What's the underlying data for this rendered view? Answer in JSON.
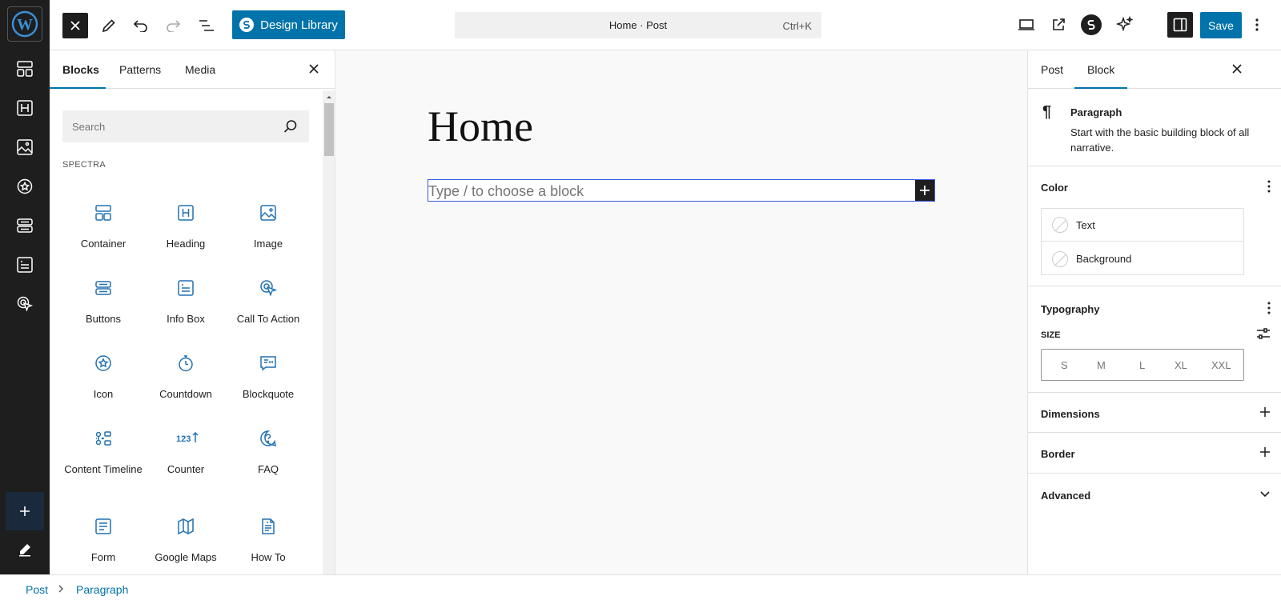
{
  "topbar": {
    "design_library_label": "Design Library",
    "command_title": "Home · Post",
    "command_shortcut": "Ctrl+K",
    "save_label": "Save"
  },
  "inserter": {
    "tabs": [
      "Blocks",
      "Patterns",
      "Media"
    ],
    "search_placeholder": "Search",
    "category": "SPECTRA",
    "blocks": [
      {
        "label": "Container",
        "icon": "container-icon"
      },
      {
        "label": "Heading",
        "icon": "heading-icon"
      },
      {
        "label": "Image",
        "icon": "image-icon"
      },
      {
        "label": "Buttons",
        "icon": "buttons-icon"
      },
      {
        "label": "Info Box",
        "icon": "info-box-icon"
      },
      {
        "label": "Call To Action",
        "icon": "call-to-action-icon"
      },
      {
        "label": "Icon",
        "icon": "star-badge-icon"
      },
      {
        "label": "Countdown",
        "icon": "stopwatch-icon"
      },
      {
        "label": "Blockquote",
        "icon": "blockquote-icon"
      },
      {
        "label": "Content Timeline",
        "icon": "timeline-icon"
      },
      {
        "label": "Counter",
        "icon": "counter-icon"
      },
      {
        "label": "FAQ",
        "icon": "faq-icon"
      },
      {
        "label": "Form",
        "icon": "form-icon"
      },
      {
        "label": "Google Maps",
        "icon": "map-icon"
      },
      {
        "label": "How To",
        "icon": "how-to-icon"
      }
    ]
  },
  "canvas": {
    "title": "Home",
    "paragraph_placeholder": "Type / to choose a block"
  },
  "settings": {
    "tabs": [
      "Post",
      "Block"
    ],
    "block_name": "Paragraph",
    "block_description": "Start with the basic building block of all narrative.",
    "color_title": "Color",
    "color_items": [
      "Text",
      "Background"
    ],
    "typography_title": "Typography",
    "size_label": "SIZE",
    "sizes": [
      "S",
      "M",
      "L",
      "XL",
      "XXL"
    ],
    "dimensions_title": "Dimensions",
    "border_title": "Border",
    "advanced_title": "Advanced"
  },
  "breadcrumb": [
    "Post",
    "Paragraph"
  ],
  "colors": {
    "accent": "#0073aa",
    "dark": "#1e1e1e"
  }
}
